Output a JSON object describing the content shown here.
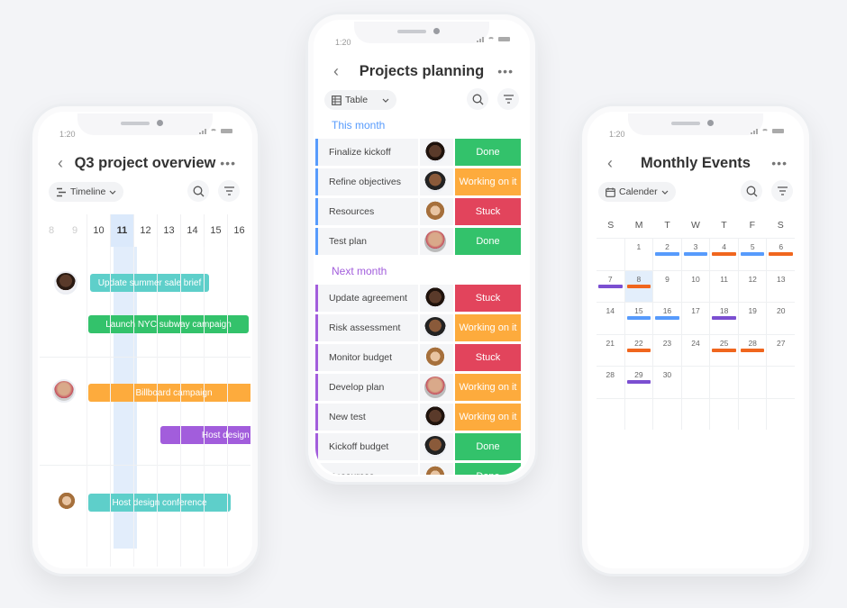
{
  "colors": {
    "teal": "#5ecfca",
    "green": "#33c26b",
    "orange": "#fdab3d",
    "purple": "#a25ddc",
    "red": "#e2445c",
    "blue_accent": "#579bfc",
    "purple_accent": "#a25ddc",
    "cal_blue": "#579bfc",
    "cal_orange": "#f0661e",
    "cal_purple": "#7b4fd1"
  },
  "phones": {
    "timeline": {
      "status_time": "1:20",
      "title": "Q3 project overview",
      "back_icon": "chevron-left-icon",
      "more_icon": "more-dots-icon",
      "view_label": "Timeline",
      "days": [
        "8",
        "9",
        "10",
        "11",
        "12",
        "13",
        "14",
        "15",
        "16"
      ],
      "today": "11",
      "bars": [
        {
          "label": "Update summer sale brief",
          "color": "teal"
        },
        {
          "label": "Launch NYC subway campaign",
          "color": "green"
        },
        {
          "label": "Billboard campaign",
          "color": "orange"
        },
        {
          "label": "Host design conference",
          "color": "purple",
          "visible_text": "Host design co"
        },
        {
          "label": "Host design conference",
          "color": "teal"
        }
      ]
    },
    "table": {
      "status_time": "1:20",
      "title": "Projects planning",
      "view_label": "Table",
      "groups": [
        {
          "label": "This month",
          "rows": [
            {
              "name": "Finalize kickoff",
              "status": "Done"
            },
            {
              "name": "Refine objectives",
              "status": "Working on it"
            },
            {
              "name": "Resources",
              "status": "Stuck"
            },
            {
              "name": "Test plan",
              "status": "Done"
            }
          ]
        },
        {
          "label": "Next month",
          "rows": [
            {
              "name": "Update agreement",
              "status": "Stuck"
            },
            {
              "name": "Risk assessment",
              "status": "Working on it"
            },
            {
              "name": "Monitor budget",
              "status": "Stuck"
            },
            {
              "name": "Develop plan",
              "status": "Working on it"
            },
            {
              "name": "New test",
              "status": "Working on it"
            },
            {
              "name": "Kickoff budget",
              "status": "Done"
            },
            {
              "name": "Resources",
              "status": "Done"
            }
          ]
        }
      ]
    },
    "calendar": {
      "status_time": "1:20",
      "title": "Monthly Events",
      "view_label": "Calender",
      "weekdays": [
        "S",
        "M",
        "T",
        "W",
        "T",
        "F",
        "S"
      ],
      "weeks": [
        [
          "",
          "1",
          "2",
          "3",
          "4",
          "5",
          "6"
        ],
        [
          "7",
          "8",
          "9",
          "10",
          "11",
          "12",
          "13"
        ],
        [
          "14",
          "15",
          "16",
          "17",
          "18",
          "19",
          "20"
        ],
        [
          "21",
          "22",
          "23",
          "24",
          "25",
          "28",
          "27"
        ],
        [
          "28",
          "29",
          "30",
          "",
          "",
          "",
          ""
        ],
        [
          "",
          "",
          "",
          "",
          "",
          "",
          ""
        ]
      ],
      "selected_day": "8",
      "events": [
        {
          "week": 0,
          "day": 2,
          "color": "cal_blue"
        },
        {
          "week": 0,
          "day": 3,
          "color": "cal_blue"
        },
        {
          "week": 0,
          "day": 4,
          "color": "cal_orange"
        },
        {
          "week": 0,
          "day": 5,
          "color": "cal_blue"
        },
        {
          "week": 0,
          "day": 6,
          "color": "cal_orange"
        },
        {
          "week": 1,
          "day": 0,
          "color": "cal_purple"
        },
        {
          "week": 1,
          "day": 1,
          "color": "cal_orange"
        },
        {
          "week": 2,
          "day": 1,
          "color": "cal_blue"
        },
        {
          "week": 2,
          "day": 2,
          "color": "cal_blue"
        },
        {
          "week": 2,
          "day": 4,
          "color": "cal_purple"
        },
        {
          "week": 3,
          "day": 1,
          "color": "cal_orange"
        },
        {
          "week": 3,
          "day": 4,
          "color": "cal_orange"
        },
        {
          "week": 3,
          "day": 5,
          "color": "cal_orange"
        },
        {
          "week": 4,
          "day": 1,
          "color": "cal_purple"
        }
      ]
    }
  }
}
